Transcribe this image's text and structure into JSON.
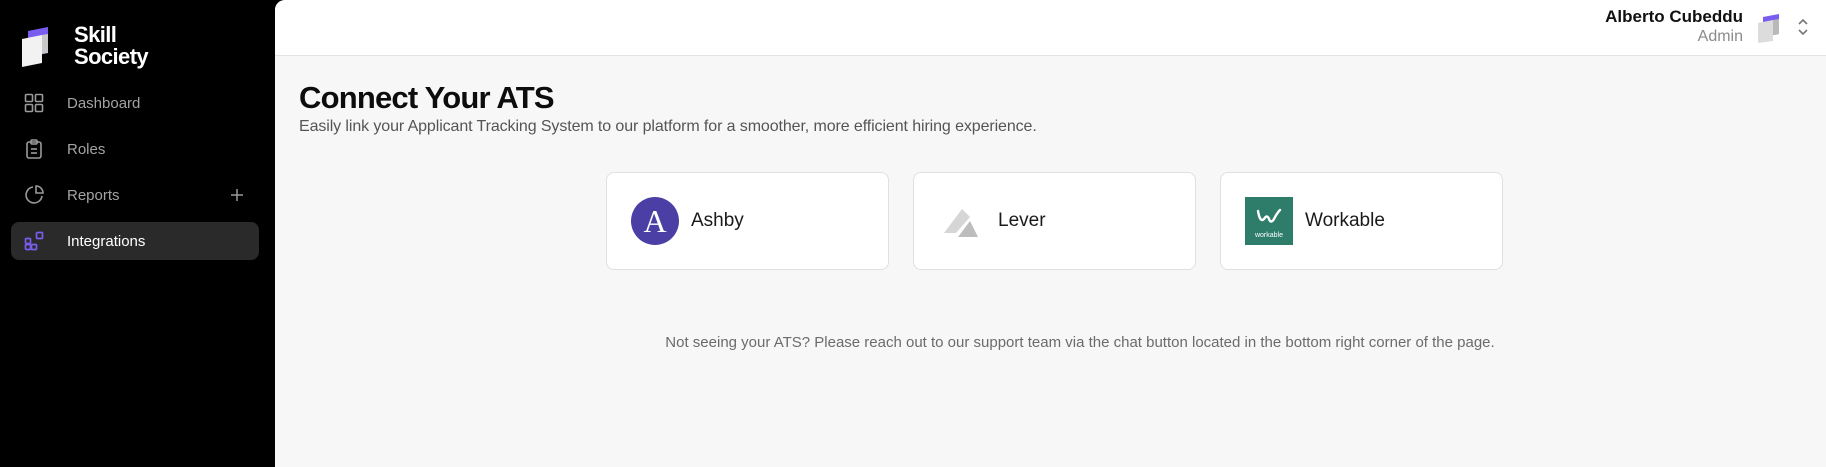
{
  "brand": {
    "line1": "Skill",
    "line2": "Society"
  },
  "sidebar": {
    "items": [
      {
        "label": "Dashboard",
        "icon": "grid-icon"
      },
      {
        "label": "Roles",
        "icon": "clipboard-icon"
      },
      {
        "label": "Reports",
        "icon": "pie-chart-icon"
      },
      {
        "label": "Integrations",
        "icon": "integrations-icon"
      }
    ],
    "active": "Integrations"
  },
  "user": {
    "name": "Alberto Cubeddu",
    "role": "Admin"
  },
  "page": {
    "title": "Connect Your ATS",
    "subtitle": "Easily link your Applicant Tracking System to our platform for a smoother, more efficient hiring experience."
  },
  "integrations": [
    {
      "name": "Ashby",
      "logo_text": "A",
      "color": "#4b3fa6"
    },
    {
      "name": "Lever",
      "color": "#cfcfcf"
    },
    {
      "name": "Workable",
      "logo_text": "workable",
      "color": "#2e7d6b"
    }
  ],
  "notice": "Not seeing your ATS? Please reach out to our support team via the chat button located in the bottom right corner of the page.",
  "colors": {
    "accent": "#7b5cf0",
    "sidebar_bg": "#000000",
    "main_bg": "#f7f7f7"
  }
}
